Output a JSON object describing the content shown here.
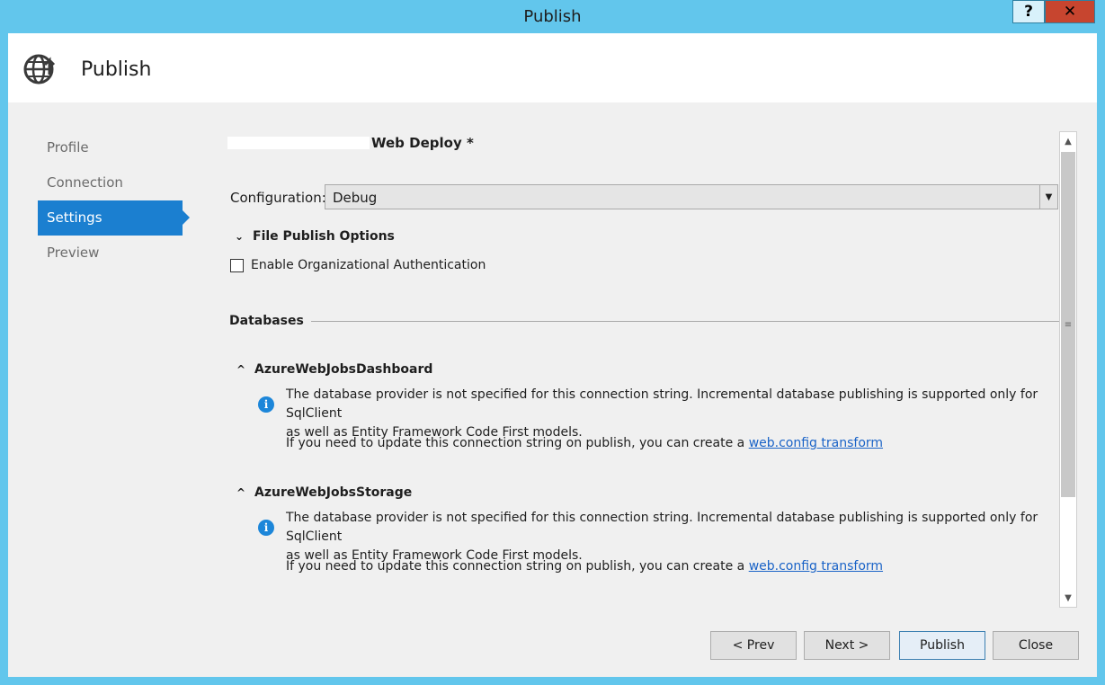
{
  "window": {
    "title": "Publish"
  },
  "titlebar_buttons": {
    "help": "?",
    "close": "✕"
  },
  "header": {
    "title": "Publish"
  },
  "nav": {
    "items": [
      {
        "label": "Profile"
      },
      {
        "label": "Connection"
      },
      {
        "label": "Settings"
      },
      {
        "label": "Preview"
      }
    ],
    "active": "Settings"
  },
  "profile": {
    "name_suffix": "Web Deploy *"
  },
  "configuration": {
    "label": "Configuration:",
    "value": "Debug"
  },
  "file_publish": {
    "title": "File Publish Options",
    "enable_org_auth_label": "Enable Organizational Authentication",
    "enable_org_auth_checked": false
  },
  "databases": {
    "title": "Databases",
    "items": [
      {
        "name": "AzureWebJobsDashboard",
        "message_line1": "The database provider is not specified for this connection string. Incremental database publishing is supported only for SqlClient",
        "message_line2": "as well as Entity Framework Code First models.",
        "transform_text": "If you need to update this connection string on publish, you can create a ",
        "transform_link": "web.config transform"
      },
      {
        "name": "AzureWebJobsStorage",
        "message_line1": "The database provider is not specified for this connection string. Incremental database publishing is supported only for SqlClient",
        "message_line2": "as well as Entity Framework Code First models.",
        "transform_text": "If you need to update this connection string on publish, you can create a ",
        "transform_link": "web.config transform"
      }
    ]
  },
  "buttons": {
    "prev": "< Prev",
    "next": "Next >",
    "publish": "Publish",
    "close": "Close"
  },
  "colors": {
    "accent": "#1b7fd0",
    "titlebar": "#62c6ec",
    "link": "#1a63c7",
    "info": "#1c86d9"
  }
}
